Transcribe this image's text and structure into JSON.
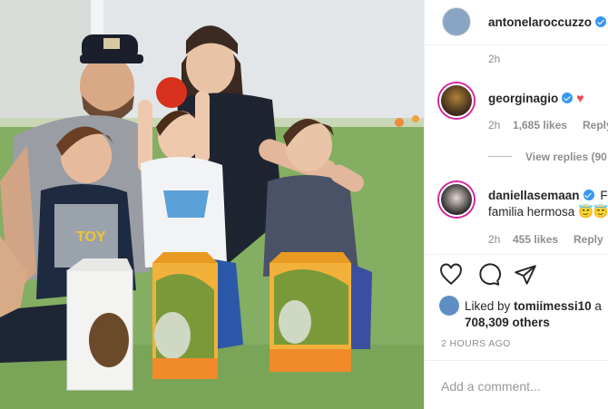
{
  "post": {
    "author": "antonelaroccuzzo",
    "top_time": "2h"
  },
  "photo": {
    "box_text": "TOY"
  },
  "comments": [
    {
      "username": "georginagio",
      "verified": true,
      "emoji": "♥",
      "time": "2h",
      "likes": "1,685 likes",
      "reply": "Reply",
      "view_replies": "View replies (90"
    },
    {
      "username": "daniellasemaan",
      "verified": true,
      "tail": "F",
      "text": "familia hermosa",
      "emoji": "😇😇",
      "time": "2h",
      "likes": "455 likes",
      "reply": "Reply"
    }
  ],
  "actions": {
    "like_icon": "heart-icon",
    "comment_icon": "comment-icon",
    "share_icon": "share-icon"
  },
  "liked_by": {
    "prefix": "Liked by",
    "user": "tomiimessi10",
    "suffix": "a",
    "count": "708,309 others"
  },
  "timestamp": "2 HOURS AGO",
  "add_comment_placeholder": "Add a comment..."
}
